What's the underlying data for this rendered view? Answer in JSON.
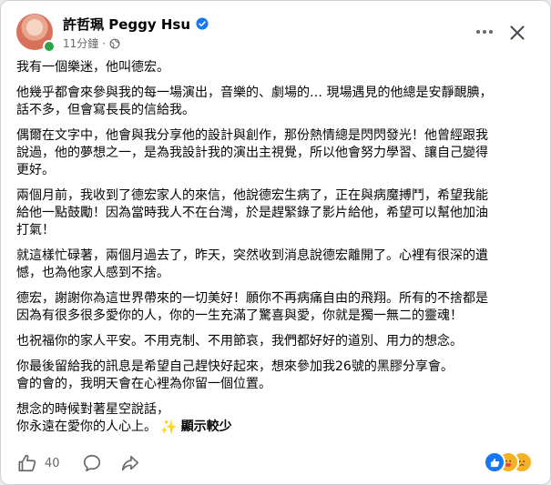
{
  "post": {
    "author": "許哲珮 Peggy Hsu",
    "timestamp": "11分鐘",
    "paragraphs": [
      "我有一個樂迷，他叫德宏。",
      "他幾乎都會來參與我的每一場演出，音樂的、劇場的… 現場遇見的他總是安靜靦腆，\n話不多，但會寫長長的信給我。",
      "偶爾在文字中，他會與我分享他的設計與創作，那份熱情總是閃閃發光！他曾經跟我\n說過，他的夢想之一，是為我設計我的演出主視覺，所以他會努力學習、讓自己變得\n更好。",
      "兩個月前，我收到了德宏家人的來信，他說德宏生病了，正在與病魔搏鬥，希望我能\n給他一點鼓勵！因為當時我人不在台灣，於是趕緊錄了影片給他，希望可以幫他加油\n打氣！",
      "就這樣忙碌著，兩個月過去了，昨天，突然收到消息說德宏離開了。心裡有很深的遺\n憾，也為他家人感到不捨。",
      "德宏，謝謝你為這世界帶來的一切美好！願你不再病痛自由的飛翔。所有的不捨都是\n因為有很多很多愛你的人，你的一生充滿了驚喜與愛，你就是獨一無二的靈魂！",
      "也祝福你的家人平安。不用克制、不用節哀，我們都好好的道別、用力的想念。",
      "你最後留給我的訊息是希望自己趕快好起來，想來參加我26號的黑膠分享會。\n會的會的，我明天會在心裡為你留一個位置。"
    ],
    "last_paragraph_line1": "想念的時候對著星空說話，",
    "last_paragraph_line2": "你永遠在愛你的人心上。",
    "sparkle": "✨",
    "show_less": "顯示較少"
  },
  "footer": {
    "like_count": "40"
  },
  "colors": {
    "like_blue": "#1877f2",
    "verified_blue": "#1877f2",
    "secondary_text": "#65676b"
  },
  "icons": {
    "like": "thumb-up-icon",
    "comment": "speech-bubble-icon",
    "share": "share-arrow-icon",
    "more": "ellipsis-icon",
    "close": "close-icon",
    "audience": "globe-icon",
    "verified": "verified-badge-icon"
  }
}
